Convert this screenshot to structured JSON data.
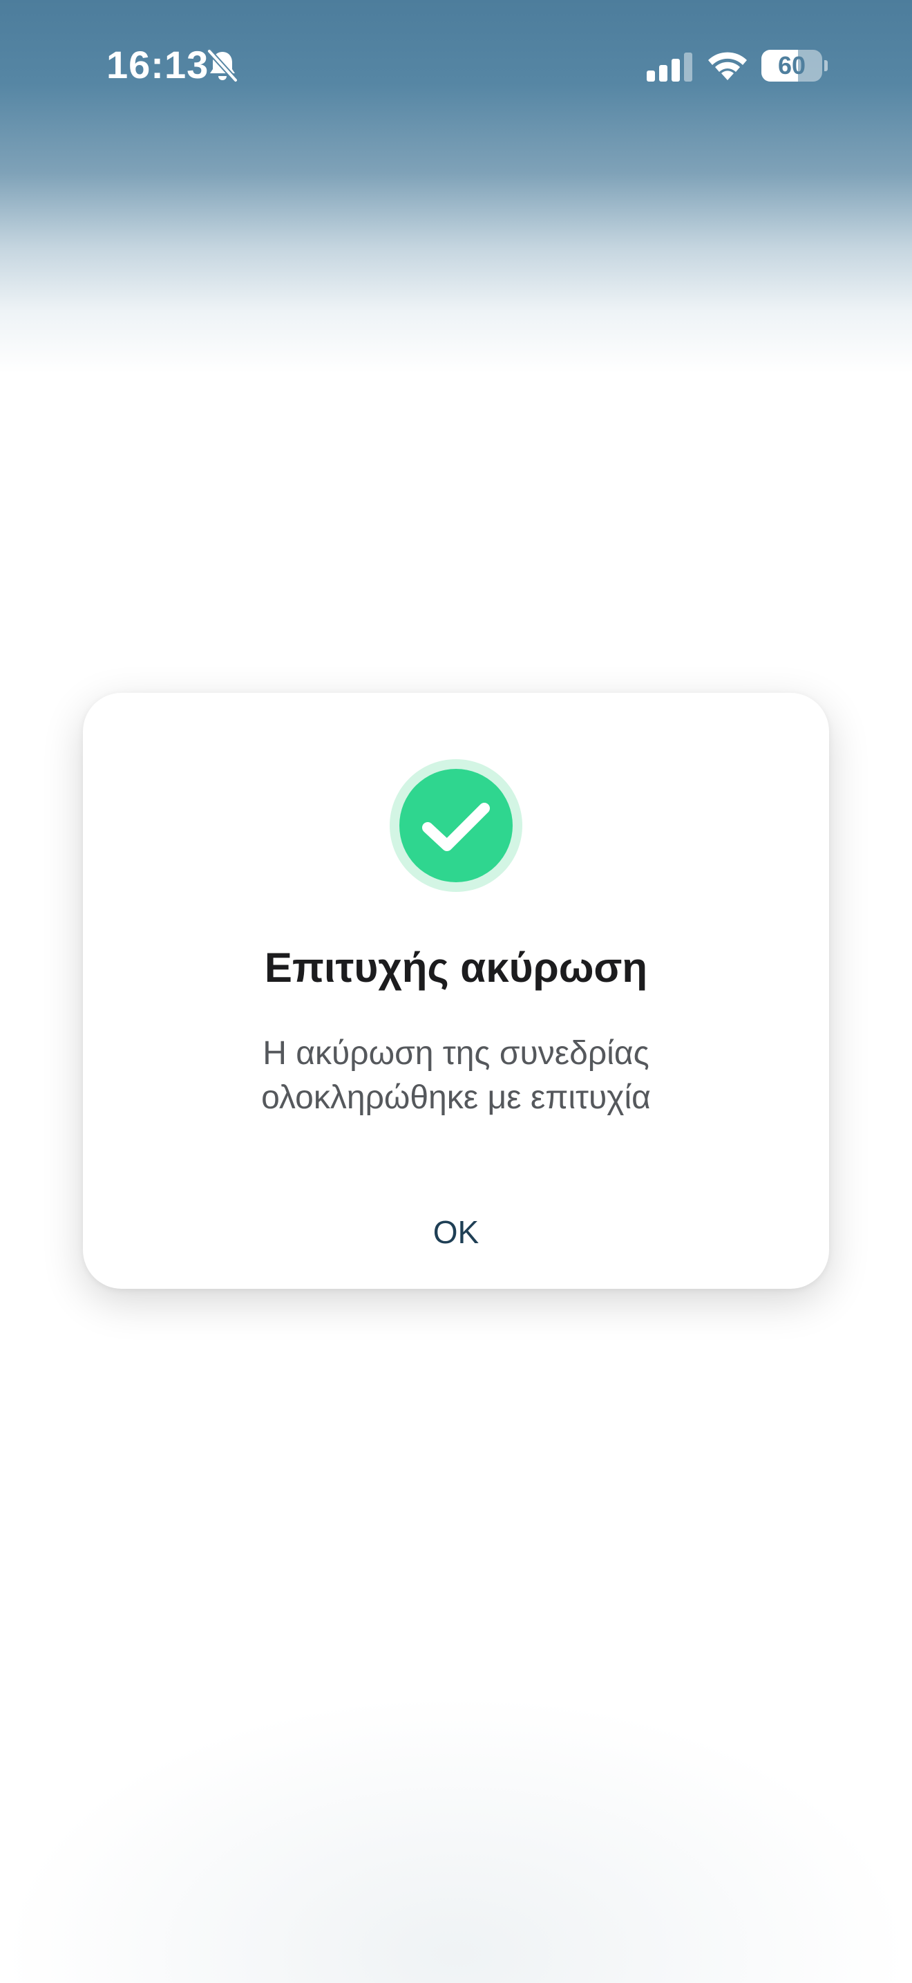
{
  "status_bar": {
    "time": "16:13",
    "battery_level": "60",
    "battery_fraction": 0.6,
    "icons": [
      "bell-slash-icon",
      "cellular-signal-icon",
      "wifi-icon",
      "battery-icon"
    ]
  },
  "dialog": {
    "icon": "checkmark-circle-icon",
    "title": "Επιτυχής ακύρωση",
    "message_line1": "Η ακύρωση της συνεδρίας",
    "message_line2": "ολοκληρώθηκε με επιτυχία",
    "ok_label": "OK"
  },
  "colors": {
    "header_blue": "#4d7d9c",
    "success_green": "#2fd68f",
    "success_ring": "#d3f5e4",
    "button_text": "#1f3f55"
  }
}
